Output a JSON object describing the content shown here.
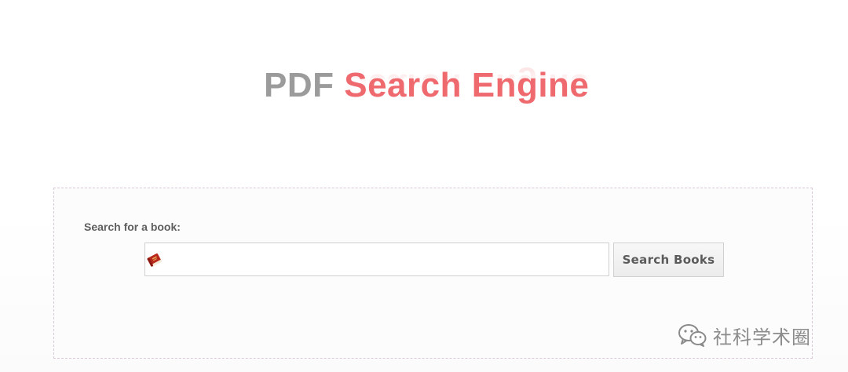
{
  "logo": {
    "part1": "PDF",
    "part2": "Search Engine",
    "colors": {
      "part1": "#9b9b9b",
      "part2": "#ef6a6f"
    }
  },
  "search": {
    "label": "Search for a book:",
    "value": "",
    "placeholder": "",
    "icon": "book-icon",
    "button_label": "Search Books"
  },
  "watermark": {
    "icon": "wechat-icon",
    "text": "社科学术圈"
  }
}
